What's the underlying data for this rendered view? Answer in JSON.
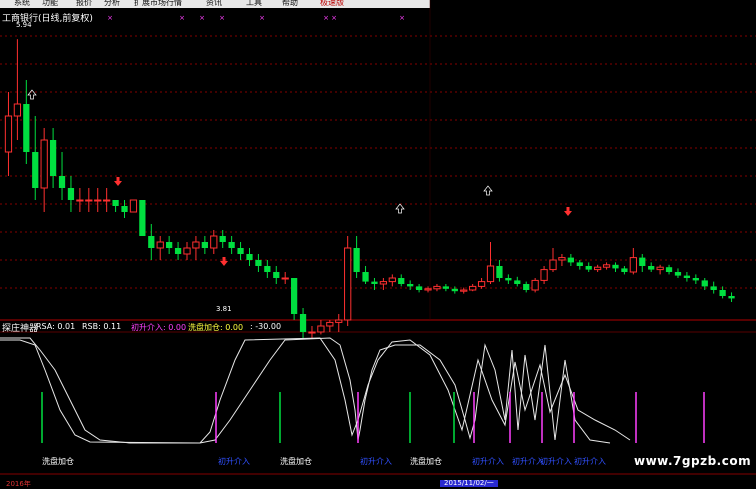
{
  "menu": {
    "items": [
      "系统",
      "功能",
      "报价",
      "分析",
      "扩展市场行情",
      "资讯",
      "工具",
      "帮助",
      "极速版"
    ]
  },
  "chart_title": "工商银行(日线,前复权)",
  "price_high_label": "5.94",
  "price_low_label": "3.81",
  "indicator": {
    "name": "探庄神器",
    "rsa_label": "RSA: 0.01",
    "rsb_label": "RSB: 0.11",
    "signal1_label": "初升介入: 0.00",
    "signal2_label": "洗盘加仓: 0.00",
    "value_label": ": -30.00"
  },
  "signal_labels": [
    "洗盘加仓",
    "初升介入",
    "洗盘加仓",
    "初升介入",
    "洗盘加仓",
    "初升介入",
    "初升介入",
    "初升介入",
    "初升介入"
  ],
  "date_tag": "2015/11/02/一",
  "bottom_left_label": "2016年",
  "watermark": "www.7gpzb.com",
  "colors": {
    "up": "#ff3030",
    "down": "#00e040",
    "pink": "#ff40ff",
    "grid": "#b00000",
    "blue": "#3050ff"
  },
  "chart_data": {
    "type": "candlestick",
    "title": "工商银行(日线,前复权)",
    "ohlc": [
      [
        5.0,
        5.5,
        4.8,
        5.3
      ],
      [
        5.3,
        5.94,
        5.1,
        5.4
      ],
      [
        5.4,
        5.6,
        4.9,
        5.0
      ],
      [
        5.0,
        5.3,
        4.6,
        4.7
      ],
      [
        4.7,
        5.2,
        4.5,
        5.1
      ],
      [
        5.1,
        5.2,
        4.7,
        4.8
      ],
      [
        4.8,
        5.0,
        4.6,
        4.7
      ],
      [
        4.7,
        4.8,
        4.5,
        4.6
      ],
      [
        4.6,
        4.7,
        4.5,
        4.6
      ],
      [
        4.6,
        4.7,
        4.5,
        4.6
      ],
      [
        4.6,
        4.7,
        4.5,
        4.6
      ],
      [
        4.6,
        4.7,
        4.5,
        4.6
      ],
      [
        4.6,
        4.6,
        4.5,
        4.55
      ],
      [
        4.55,
        4.6,
        4.45,
        4.5
      ],
      [
        4.5,
        4.6,
        4.5,
        4.6
      ],
      [
        4.6,
        4.6,
        4.3,
        4.3
      ],
      [
        4.3,
        4.4,
        4.1,
        4.2
      ],
      [
        4.2,
        4.3,
        4.1,
        4.25
      ],
      [
        4.25,
        4.3,
        4.15,
        4.2
      ],
      [
        4.2,
        4.25,
        4.1,
        4.15
      ],
      [
        4.15,
        4.25,
        4.1,
        4.2
      ],
      [
        4.2,
        4.3,
        4.1,
        4.25
      ],
      [
        4.25,
        4.3,
        4.15,
        4.2
      ],
      [
        4.2,
        4.35,
        4.15,
        4.3
      ],
      [
        4.3,
        4.35,
        4.2,
        4.25
      ],
      [
        4.25,
        4.3,
        4.15,
        4.2
      ],
      [
        4.2,
        4.25,
        4.1,
        4.15
      ],
      [
        4.15,
        4.2,
        4.05,
        4.1
      ],
      [
        4.1,
        4.15,
        4.0,
        4.05
      ],
      [
        4.05,
        4.1,
        3.95,
        4.0
      ],
      [
        4.0,
        4.05,
        3.9,
        3.95
      ],
      [
        3.95,
        4.0,
        3.9,
        3.95
      ],
      [
        3.95,
        3.95,
        3.6,
        3.65
      ],
      [
        3.65,
        3.7,
        3.45,
        3.5
      ],
      [
        3.5,
        3.55,
        3.45,
        3.5
      ],
      [
        3.5,
        3.6,
        3.48,
        3.55
      ],
      [
        3.55,
        3.6,
        3.5,
        3.58
      ],
      [
        3.58,
        3.65,
        3.5,
        3.6
      ],
      [
        3.6,
        4.3,
        3.55,
        4.2
      ],
      [
        4.2,
        4.3,
        3.95,
        4.0
      ],
      [
        4.0,
        4.05,
        3.9,
        3.92
      ],
      [
        3.92,
        3.95,
        3.85,
        3.9
      ],
      [
        3.9,
        3.95,
        3.85,
        3.92
      ],
      [
        3.92,
        3.98,
        3.88,
        3.95
      ],
      [
        3.95,
        3.98,
        3.88,
        3.9
      ],
      [
        3.9,
        3.93,
        3.85,
        3.88
      ],
      [
        3.88,
        3.9,
        3.83,
        3.85
      ],
      [
        3.85,
        3.88,
        3.83,
        3.86
      ],
      [
        3.86,
        3.9,
        3.84,
        3.88
      ],
      [
        3.88,
        3.9,
        3.84,
        3.86
      ],
      [
        3.86,
        3.88,
        3.82,
        3.84
      ],
      [
        3.84,
        3.87,
        3.82,
        3.85
      ],
      [
        3.85,
        3.9,
        3.84,
        3.88
      ],
      [
        3.88,
        3.95,
        3.86,
        3.92
      ],
      [
        3.92,
        4.25,
        3.9,
        4.05
      ],
      [
        4.05,
        4.1,
        3.92,
        3.95
      ],
      [
        3.95,
        3.98,
        3.9,
        3.93
      ],
      [
        3.93,
        3.96,
        3.88,
        3.9
      ],
      [
        3.9,
        3.92,
        3.83,
        3.85
      ],
      [
        3.85,
        3.95,
        3.83,
        3.93
      ],
      [
        3.93,
        4.05,
        3.9,
        4.02
      ],
      [
        4.02,
        4.2,
        4.0,
        4.1
      ],
      [
        4.1,
        4.15,
        4.05,
        4.12
      ],
      [
        4.12,
        4.15,
        4.05,
        4.08
      ],
      [
        4.08,
        4.1,
        4.02,
        4.05
      ],
      [
        4.05,
        4.08,
        4.0,
        4.02
      ],
      [
        4.02,
        4.06,
        4.0,
        4.04
      ],
      [
        4.04,
        4.08,
        4.02,
        4.06
      ],
      [
        4.06,
        4.08,
        4.0,
        4.03
      ],
      [
        4.03,
        4.05,
        3.98,
        4.0
      ],
      [
        4.0,
        4.2,
        3.98,
        4.12
      ],
      [
        4.12,
        4.15,
        4.0,
        4.05
      ],
      [
        4.05,
        4.08,
        4.0,
        4.02
      ],
      [
        4.02,
        4.06,
        3.98,
        4.04
      ],
      [
        4.04,
        4.06,
        3.98,
        4.0
      ],
      [
        4.0,
        4.03,
        3.95,
        3.97
      ],
      [
        3.97,
        4.0,
        3.92,
        3.95
      ],
      [
        3.95,
        3.98,
        3.9,
        3.93
      ],
      [
        3.93,
        3.95,
        3.85,
        3.88
      ],
      [
        3.88,
        3.92,
        3.82,
        3.85
      ],
      [
        3.85,
        3.88,
        3.78,
        3.8
      ],
      [
        3.8,
        3.83,
        3.75,
        3.78
      ]
    ],
    "y_range": [
      3.6,
      6.1
    ],
    "price_labels": {
      "high": "5.94",
      "low": "3.81"
    }
  }
}
